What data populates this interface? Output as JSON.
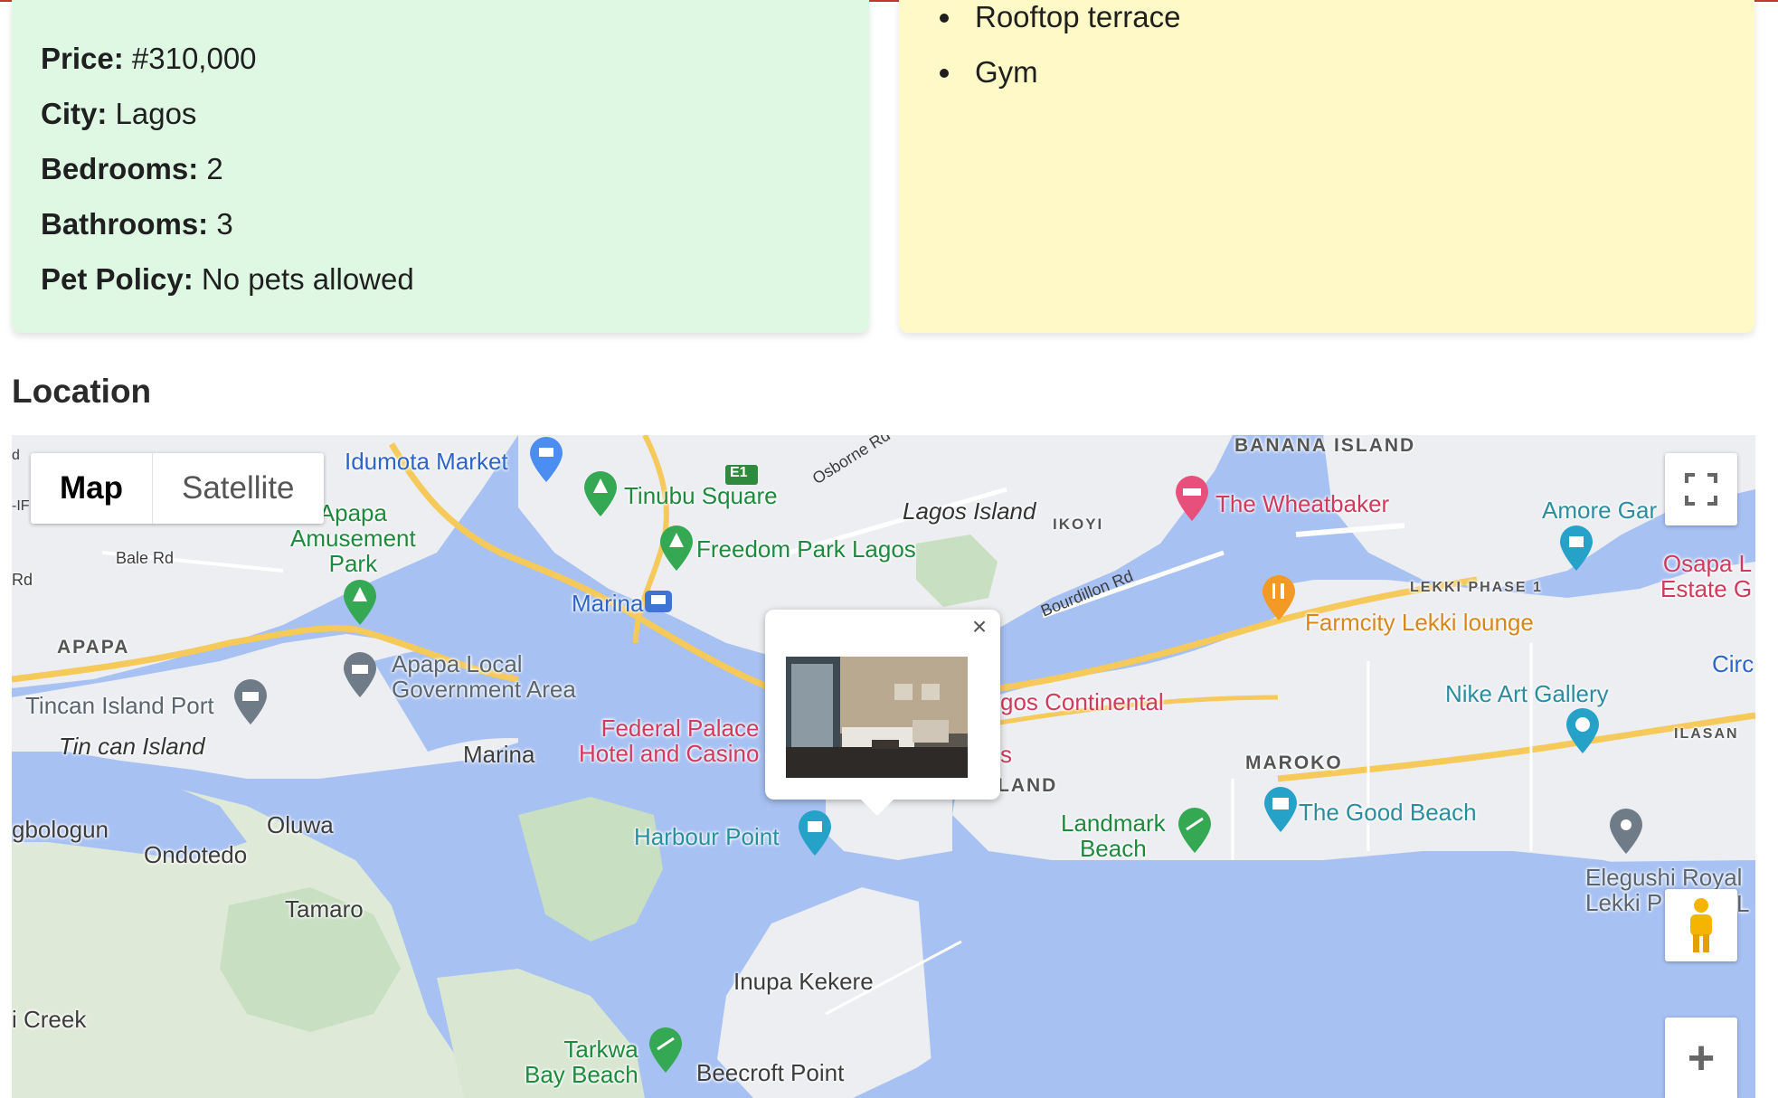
{
  "details": {
    "price": {
      "label": "Price:",
      "value": "#310,000"
    },
    "city": {
      "label": "City:",
      "value": "Lagos"
    },
    "bedrooms": {
      "label": "Bedrooms:",
      "value": "2"
    },
    "bathrooms": {
      "label": "Bathrooms:",
      "value": "3"
    },
    "pet_policy": {
      "label": "Pet Policy:",
      "value": "No pets allowed"
    }
  },
  "amenities": [
    "Rooftop terrace",
    "Gym"
  ],
  "location": {
    "title": "Location",
    "map_type": {
      "map": "Map",
      "satellite": "Satellite",
      "active": "Map"
    },
    "controls": {
      "zoom_in": "+"
    },
    "popup": {
      "close": "×"
    },
    "labels": {
      "banana_island": "BANANA ISLAND",
      "idumota_market": "Idumota Market",
      "tinubu_square": "Tinubu Square",
      "osborne_rd": "Osborne Rd",
      "e1": "E1",
      "lagos_island": "Lagos Island",
      "ikoyi": "IKOYI",
      "wheatbaker": "The Wheatbaker",
      "amore": "Amore Gar",
      "apapa_amusement": "Apapa\nAmusement\nPark",
      "freedom_park": "Freedom Park Lagos",
      "bale_rd": "Bale Rd",
      "rd": "Rd",
      "if": "-IF",
      "d": "d",
      "osapa": "Osapa L\nEstate G",
      "marina_station": "Marina",
      "bourdillon": "Bourdillon Rd",
      "lekki_phase1": "LEKKI PHASE 1",
      "farmcity": "Farmcity Lekki lounge",
      "apapa": "APAPA",
      "apapa_lga": "Apapa Local\nGovernment Area",
      "circ": "Circ",
      "tincan_port": "Tincan Island Port",
      "lagos_continental": "gos Continental",
      "nike_art": "Nike Art Gallery",
      "federal_palace": "Federal Palace\nHotel and Casino",
      "ilasan": "ILASAN",
      "tincan_island": "Tin can Island",
      "marina": "Marina",
      "s": "s",
      "maroko": "MAROKO",
      "island": "LAND",
      "oluwa": "Oluwa",
      "landmark_beach": "Landmark\nBeach",
      "good_beach": "The Good Beach",
      "gbologun": "gbologun",
      "ondotedo": "Ondotedo",
      "harbour_point": "Harbour Point",
      "elegushi": "Elegushi Royal\nLekki P",
      "l": "L",
      "tamaro": "Tamaro",
      "inupa_kekere": "Inupa Kekere",
      "creek": "i Creek",
      "tarkwa_bay": "Tarkwa\nBay Beach",
      "beecroft": "Beecroft Point"
    }
  }
}
